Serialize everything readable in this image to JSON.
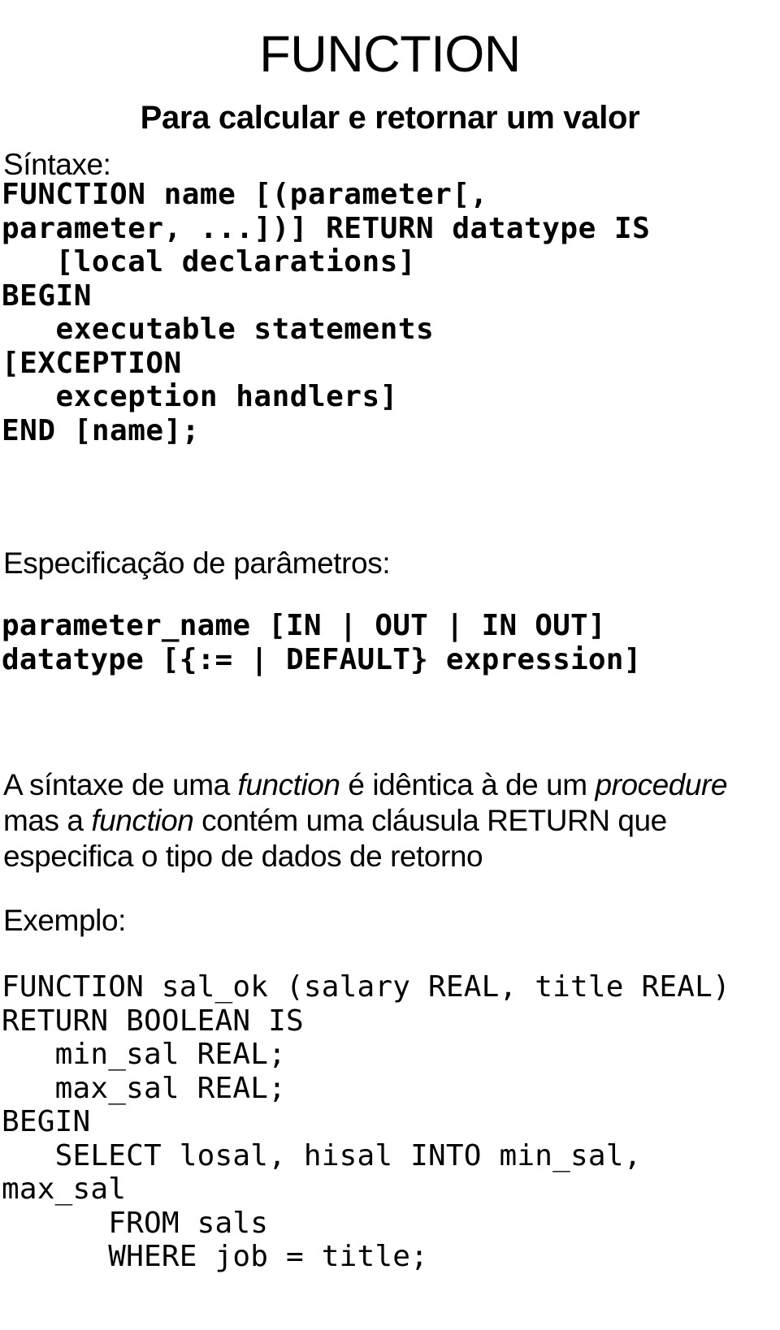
{
  "title": "FUNCTION",
  "subtitle": "Para calcular e retornar um valor",
  "sections": {
    "syntax_label": "Síntaxe:",
    "params_label": "Especificação de parâmetros:",
    "example_label": "Exemplo:"
  },
  "syntax_block": "FUNCTION name [(parameter[,\nparameter, ...])] RETURN datatype IS\n   [local declarations]\nBEGIN\n   executable statements\n[EXCEPTION\n   exception handlers]\nEND [name];",
  "param_spec_block": "parameter_name [IN | OUT | IN OUT]\ndatatype [{:= | DEFAULT} expression]",
  "body_text": {
    "line1_a": "A síntaxe de uma ",
    "line1_em1": "function",
    "line1_b": " é idêntica à de um ",
    "line1_em2": "procedure",
    "line2_a": "mas a ",
    "line2_em1": "function",
    "line2_b": " contém uma cláusula RETURN que",
    "line3": "especifica o tipo de dados de retorno"
  },
  "example_block": "FUNCTION sal_ok (salary REAL, title REAL)\nRETURN BOOLEAN IS\n   min_sal REAL;\n   max_sal REAL;\nBEGIN\n   SELECT losal, hisal INTO min_sal,\nmax_sal\n      FROM sals\n      WHERE job = title;",
  "colors": {
    "background": "#ffffff",
    "text": "#000000"
  }
}
